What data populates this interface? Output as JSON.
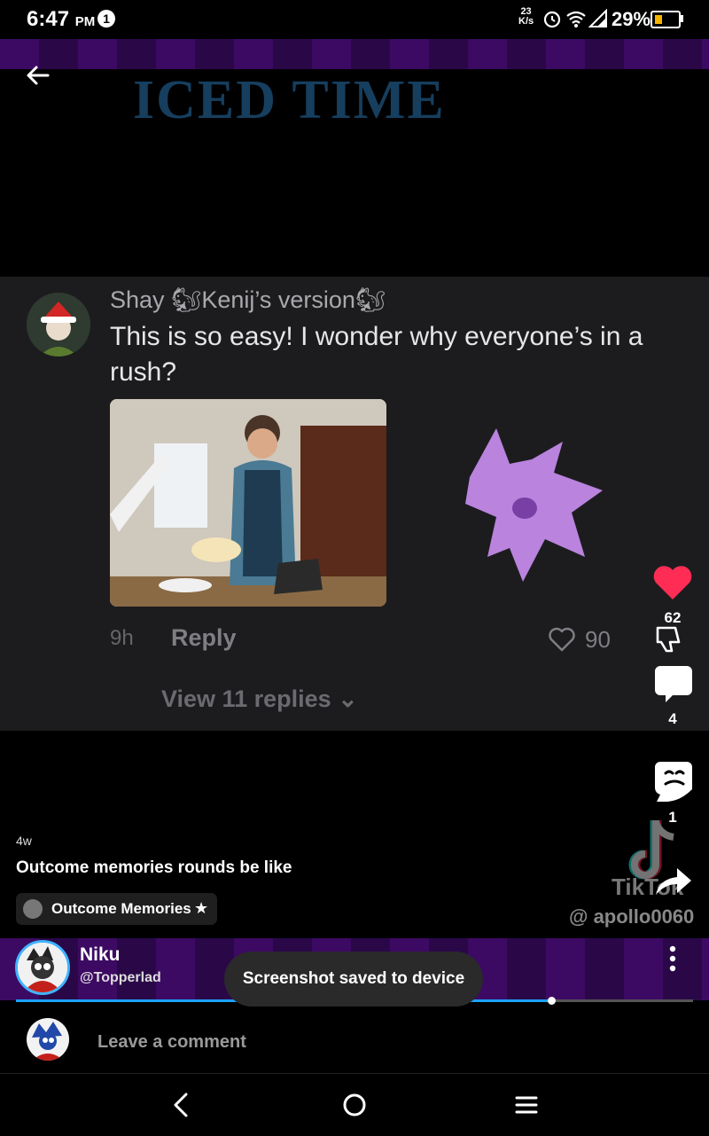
{
  "status_bar": {
    "time": "6:47",
    "ampm": "PM",
    "notification_count": "1",
    "net_speed_value": "23",
    "net_speed_unit": "K/s",
    "battery": "29%"
  },
  "video": {
    "title": "ICED TIME",
    "watermark_brand": "TikTok",
    "watermark_handle": "@ apollo0060"
  },
  "comment": {
    "author": "Shay 🐿Kenij’s version🐿",
    "text": "This is so easy! I wonder why everyone’s in a rush?",
    "time": "9h",
    "reply_label": "Reply",
    "likes": "90",
    "view_replies": "View 11 replies"
  },
  "actions": {
    "likes": "62",
    "comments": "4",
    "remixes": "1"
  },
  "post": {
    "age": "4w",
    "caption": "Outcome memories rounds be like",
    "community": "Outcome Memories"
  },
  "author": {
    "name": "Niku",
    "handle": "@Topperlad"
  },
  "playback": {
    "progress": 0.79
  },
  "toast": "Screenshot saved to device",
  "composer": {
    "placeholder": "Leave a comment"
  },
  "colors": {
    "like": "#ff2d55",
    "accent_blue": "#1aa3ff",
    "band_purple": "#3c0a63",
    "ghost": "#b983de"
  }
}
